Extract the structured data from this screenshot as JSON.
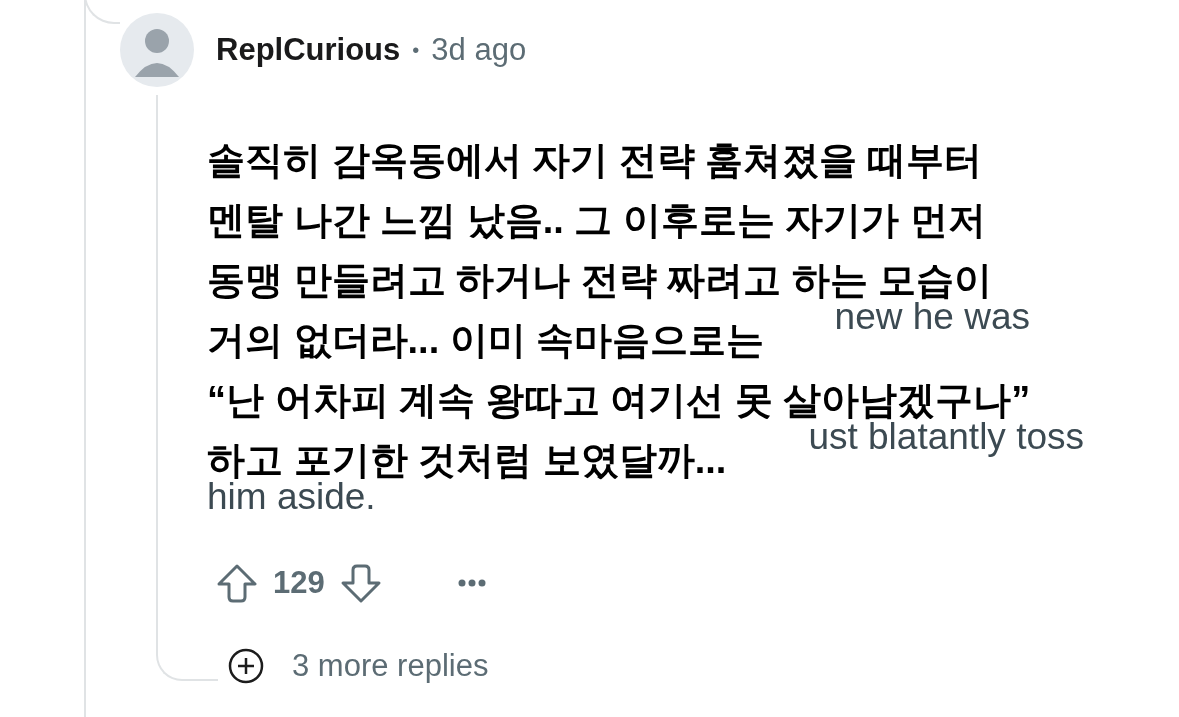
{
  "comment": {
    "author": "ReplCurious",
    "separator": "•",
    "time": "3d ago",
    "body_fragments": [
      "new he was",
      "ust blatantly toss",
      "him aside."
    ],
    "translation_overlay": [
      "솔직히 감옥동에서 자기 전략 훔쳐졌을 때부터",
      "멘탈 나간 느낌 났음.. 그 이후로는 자기가 먼저",
      "동맹 만들려고 하거나 전략 짜려고 하는 모습이",
      "거의 없더라... 이미 속마음으로는",
      "“난 어차피 계속 왕따고 여기선 못 살아남겠구나”",
      "하고 포기한 것처럼 보였달까..."
    ],
    "score": "129",
    "more_replies": "3 more replies"
  }
}
